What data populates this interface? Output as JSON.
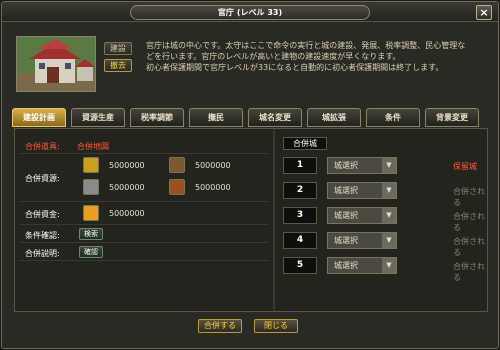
{
  "window": {
    "title": "官庁",
    "level": "(レベル 33)",
    "close_symbol": "×"
  },
  "header": {
    "build_label": "建設",
    "demolish_label": "撤去",
    "description": [
      "官庁は城の中心です。太守はここで命令の実行と城の建設、発展、税率調整、民心管理な",
      "どを行います。官庁のレベルが高いと建物の建設速度が早くなります。",
      "初心者保護期間で官庁レベルが33になると自動的に初心者保護期間は終了します。"
    ]
  },
  "tabs": [
    {
      "label": "建設計画",
      "active": true
    },
    {
      "label": "資源生産",
      "active": false
    },
    {
      "label": "税率調節",
      "active": false
    },
    {
      "label": "撫民",
      "active": false
    },
    {
      "label": "城名変更",
      "active": false
    },
    {
      "label": "城拡張",
      "active": false
    },
    {
      "label": "条件",
      "active": false
    },
    {
      "label": "背景変更",
      "active": false
    }
  ],
  "merge": {
    "tool_label": "合併道具:",
    "tool_value": "合併地図",
    "resource_label": "合併資源:",
    "resources": [
      {
        "icon": "food-icon",
        "value": "5000000",
        "color": "#c8a020"
      },
      {
        "icon": "wood-icon",
        "value": "5000000",
        "color": "#7a5a30"
      },
      {
        "icon": "stone-icon",
        "value": "5000000",
        "color": "#8a8a88"
      },
      {
        "icon": "iron-icon",
        "value": "5000000",
        "color": "#9a5020"
      }
    ],
    "funds_label": "合併資金:",
    "funds_value": "5000000",
    "funds_icon_color": "#e8a020",
    "condition_label": "条件確認:",
    "condition_button": "検索",
    "explain_label": "合併説明:",
    "explain_button": "確認"
  },
  "merge_list": {
    "header": "合併城",
    "select_default": "城選択",
    "rows": [
      {
        "num": "1",
        "status": "保留城",
        "status_red": true
      },
      {
        "num": "2",
        "status": "合併される",
        "status_red": false
      },
      {
        "num": "3",
        "status": "合併される",
        "status_red": false
      },
      {
        "num": "4",
        "status": "合併される",
        "status_red": false
      },
      {
        "num": "5",
        "status": "合併される",
        "status_red": false
      }
    ]
  },
  "footer": {
    "merge_button": "合併する",
    "close_button": "閉じる"
  }
}
